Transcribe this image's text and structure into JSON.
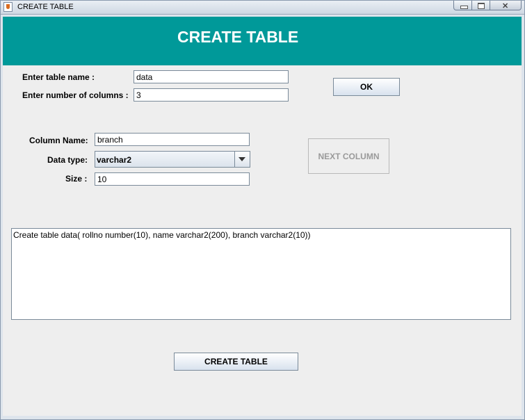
{
  "window": {
    "title": "CREATE TABLE"
  },
  "banner": {
    "title": "CREATE TABLE"
  },
  "form": {
    "table_name_label": "Enter table name :",
    "table_name_value": "data",
    "num_columns_label": "Enter number of columns :",
    "num_columns_value": "3",
    "ok_label": "OK",
    "column_name_label": "Column Name:",
    "column_name_value": "branch",
    "data_type_label": "Data type:",
    "data_type_value": "varchar2",
    "size_label": "Size :",
    "size_value": "10",
    "next_column_label": "NEXT COLUMN",
    "next_column_enabled": false
  },
  "output": {
    "query_text": "Create table data( rollno number(10), name varchar2(200), branch varchar2(10))"
  },
  "actions": {
    "create_table_label": "CREATE TABLE"
  },
  "colors": {
    "banner": "#009999",
    "panel": "#eeeeee"
  }
}
